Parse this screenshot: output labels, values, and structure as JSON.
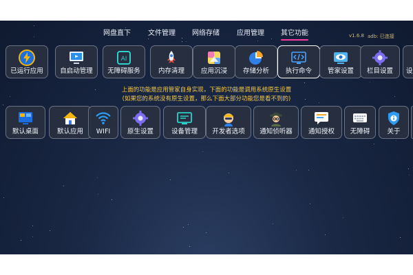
{
  "nav": {
    "tabs": [
      {
        "label": "网盘直下",
        "active": false
      },
      {
        "label": "文件管理",
        "active": false
      },
      {
        "label": "网络存储",
        "active": false
      },
      {
        "label": "应用管理",
        "active": false
      },
      {
        "label": "其它功能",
        "active": true
      }
    ],
    "version": "v1.6.8",
    "adb_status": "adb: 已连接"
  },
  "row1": [
    {
      "label": "已运行应用",
      "icon": "lightning-icon"
    },
    {
      "label": "自启动管理",
      "icon": "monitor-icon"
    },
    {
      "label": "无障碍服务",
      "icon": "ai-icon"
    },
    {
      "label": "内存清理",
      "icon": "rocket-icon"
    },
    {
      "label": "应用沉浸",
      "icon": "gallery-icon"
    },
    {
      "label": "存储分析",
      "icon": "pie-chart-icon"
    },
    {
      "label": "执行命令",
      "icon": "code-terminal-icon",
      "selected": true
    },
    {
      "label": "管家设置",
      "icon": "eye-settings-icon"
    },
    {
      "label": "栏目设置",
      "icon": "gear-icon"
    },
    {
      "label": "设",
      "icon": "gear-icon"
    }
  ],
  "notice": {
    "line1": "上面的功能是应用管家自身实现，下面的功能是调用系统原生设置",
    "line2": "(如果您的系统没有原生设置，那么下面大部分功能您是看不到的)"
  },
  "row2": [
    {
      "label": "默认桌面",
      "icon": "desktop-icon"
    },
    {
      "label": "默认应用",
      "icon": "home-icon"
    },
    {
      "label": "WIFI",
      "icon": "wifi-icon"
    },
    {
      "label": "原生设置",
      "icon": "gear-icon"
    },
    {
      "label": "设备管理",
      "icon": "device-icon"
    },
    {
      "label": "开发者选项",
      "icon": "developer-icon"
    },
    {
      "label": "通知侦听器",
      "icon": "detective-icon"
    },
    {
      "label": "通知授权",
      "icon": "message-icon"
    },
    {
      "label": "无障碍",
      "icon": "keyboard-icon"
    },
    {
      "label": "关于",
      "icon": "shield-info-icon"
    }
  ],
  "colors": {
    "accent": "#ff3aa0",
    "notice": "#f3c84a",
    "version": "#d7b86a"
  }
}
